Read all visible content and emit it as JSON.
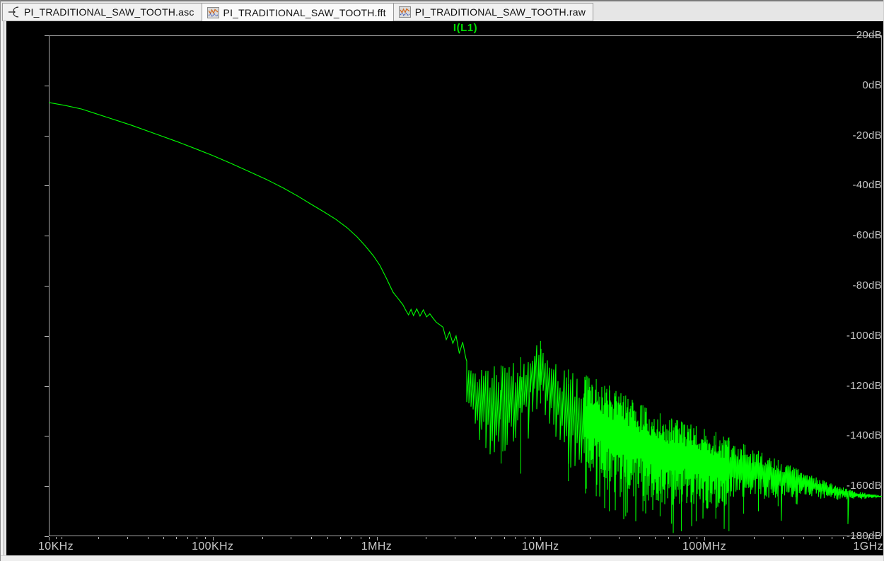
{
  "window": {
    "app": "waveform-viewer",
    "tabs": [
      {
        "label": "PI_TRADITIONAL_SAW_TOOTH.asc",
        "icon": "schematic-icon",
        "active": false
      },
      {
        "label": "PI_TRADITIONAL_SAW_TOOTH.fft",
        "icon": "waveform-icon",
        "active": true
      },
      {
        "label": "PI_TRADITIONAL_SAW_TOOTH.raw",
        "icon": "waveform-icon",
        "active": false
      }
    ]
  },
  "colors": {
    "trace": "#00ff00",
    "title": "#00e000",
    "axis_line": "#a8a8a8",
    "axis_text": "#c8c8c8",
    "plot_bg": "#000000",
    "chrome_bg": "#e6e6e6",
    "icon_orange": "#d2691e",
    "icon_blue": "#3a55bb"
  },
  "chart_data": {
    "type": "line",
    "title": "I(L1)",
    "legend_position": "top-center",
    "grid": false,
    "x_axis": {
      "scale": "log",
      "unit": "Hz",
      "min_log10": 4,
      "max_log10": 9.083,
      "tick_log10": [
        4,
        5,
        6,
        7,
        8,
        9
      ],
      "tick_labels": [
        "10KHz",
        "100KHz",
        "1MHz",
        "10MHz",
        "100MHz",
        "1GHz"
      ]
    },
    "y_axis": {
      "unit": "dB",
      "min": -180,
      "max": 20,
      "step": 20,
      "tick_labels": [
        "20dB",
        "0dB",
        "-20dB",
        "-40dB",
        "-60dB",
        "-80dB",
        "-100dB",
        "-120dB",
        "-140dB",
        "-160dB",
        "-180dB"
      ]
    },
    "series": [
      {
        "name": "I(L1)",
        "color": "#00ff00"
      }
    ],
    "backbone_points_logf_db": [
      [
        4.0,
        -6.8
      ],
      [
        4.1,
        -8.0
      ],
      [
        4.2,
        -9.4
      ],
      [
        4.35,
        -12.6
      ],
      [
        4.5,
        -15.8
      ],
      [
        4.65,
        -19.3
      ],
      [
        4.79,
        -22.6
      ],
      [
        4.9,
        -25.4
      ],
      [
        5.0,
        -28.0
      ],
      [
        5.1,
        -30.8
      ],
      [
        5.22,
        -34.3
      ],
      [
        5.33,
        -37.6
      ],
      [
        5.43,
        -40.9
      ],
      [
        5.52,
        -44.2
      ],
      [
        5.6,
        -47.4
      ],
      [
        5.68,
        -50.5
      ],
      [
        5.75,
        -53.4
      ],
      [
        5.82,
        -56.8
      ],
      [
        5.88,
        -60.4
      ],
      [
        5.93,
        -64.0
      ],
      [
        5.98,
        -68.0
      ],
      [
        6.02,
        -71.8
      ],
      [
        6.06,
        -77.0
      ],
      [
        6.1,
        -82.5
      ],
      [
        6.13,
        -85.0
      ],
      [
        6.16,
        -87.5
      ],
      [
        6.18,
        -90.0
      ],
      [
        6.195,
        -91.6
      ],
      [
        6.21,
        -89.4
      ],
      [
        6.225,
        -91.9
      ],
      [
        6.245,
        -89.2
      ],
      [
        6.265,
        -92.1
      ],
      [
        6.285,
        -89.6
      ],
      [
        6.305,
        -92.4
      ],
      [
        6.325,
        -91.2
      ],
      [
        6.345,
        -93.0
      ],
      [
        6.365,
        -94.6
      ],
      [
        6.385,
        -95.5
      ],
      [
        6.405,
        -96.5
      ],
      [
        6.425,
        -101.5
      ],
      [
        6.445,
        -98.5
      ],
      [
        6.465,
        -103.0
      ],
      [
        6.485,
        -100.0
      ],
      [
        6.505,
        -107.0
      ],
      [
        6.525,
        -102.5
      ],
      [
        6.545,
        -109.0
      ]
    ],
    "noise_start_log10": 6.55,
    "noise_envelope_logf_topdb_botdb": [
      [
        6.55,
        -109,
        -128
      ],
      [
        6.6,
        -111,
        -140
      ],
      [
        6.67,
        -112,
        -147
      ],
      [
        6.75,
        -112,
        -150
      ],
      [
        6.85,
        -110,
        -144
      ],
      [
        6.93,
        -106,
        -135
      ],
      [
        7.0,
        -102,
        -127
      ],
      [
        7.07,
        -109,
        -140
      ],
      [
        7.15,
        -113,
        -152
      ],
      [
        7.25,
        -115,
        -155
      ],
      [
        7.33,
        -117,
        -160
      ],
      [
        7.4,
        -119,
        -162
      ],
      [
        7.5,
        -123,
        -165
      ],
      [
        7.6,
        -127,
        -166
      ],
      [
        7.7,
        -130,
        -167
      ],
      [
        7.8,
        -133,
        -169
      ],
      [
        7.9,
        -135,
        -167
      ],
      [
        8.0,
        -137,
        -169
      ],
      [
        8.1,
        -139,
        -171
      ],
      [
        8.2,
        -142,
        -167
      ],
      [
        8.3,
        -145,
        -166
      ],
      [
        8.4,
        -148,
        -165
      ],
      [
        8.5,
        -151,
        -164.5
      ],
      [
        8.6,
        -154,
        -164.5
      ],
      [
        8.7,
        -157,
        -165
      ],
      [
        8.8,
        -159.5,
        -165.5
      ],
      [
        8.9,
        -161.5,
        -165.5
      ],
      [
        9.0,
        -163,
        -165
      ],
      [
        9.083,
        -164,
        -164.3
      ]
    ],
    "deep_spikes_logf_db": [
      [
        6.76,
        -151
      ],
      [
        6.88,
        -155
      ],
      [
        7.0,
        -127
      ],
      [
        7.17,
        -158
      ],
      [
        7.28,
        -161
      ],
      [
        7.34,
        -164
      ],
      [
        7.42,
        -170
      ],
      [
        7.52,
        -172
      ],
      [
        7.625,
        -170
      ],
      [
        7.73,
        -172
      ],
      [
        7.8,
        -175
      ],
      [
        7.86,
        -178
      ],
      [
        7.95,
        -174
      ],
      [
        8.07,
        -173
      ],
      [
        8.15,
        -178
      ],
      [
        8.24,
        -171
      ],
      [
        8.33,
        -170
      ],
      [
        8.45,
        -168
      ],
      [
        8.56,
        -167
      ]
    ],
    "peak_annotation": {
      "freq": "10MHz",
      "value_db": -102
    },
    "end_value_db": -164
  }
}
